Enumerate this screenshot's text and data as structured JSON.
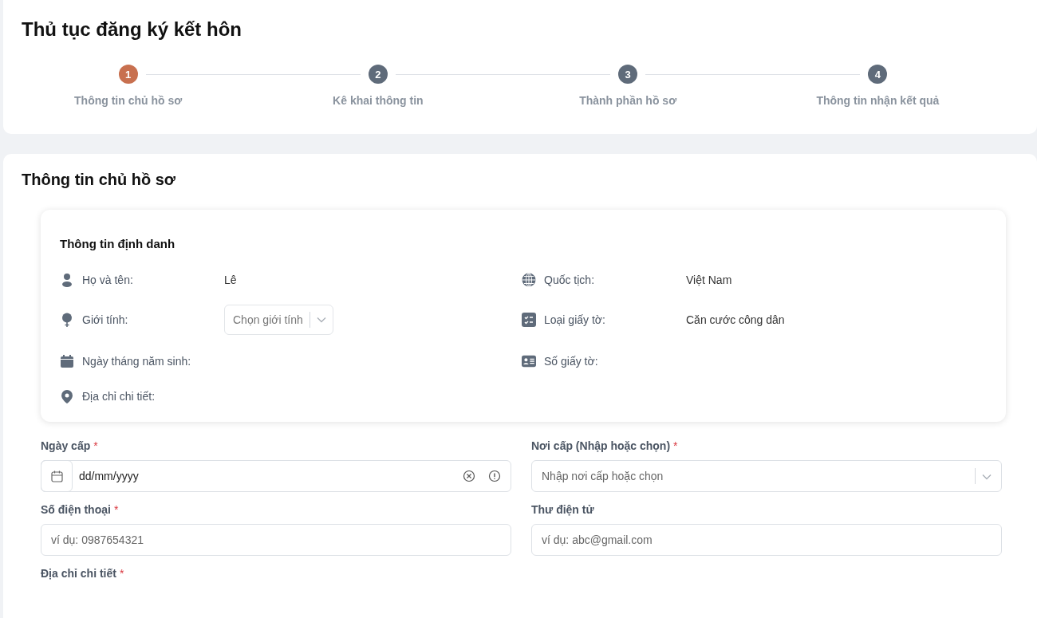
{
  "title": "Thủ tục đăng ký kết hôn",
  "steps": [
    {
      "number": "1",
      "label": "Thông tin chủ hồ sơ",
      "selected": true
    },
    {
      "number": "2",
      "label": "Kê khai thông tin",
      "selected": false
    },
    {
      "number": "3",
      "label": "Thành phần hồ sơ",
      "selected": false
    },
    {
      "number": "4",
      "label": "Thông tin nhận kết quả",
      "selected": false
    }
  ],
  "section_title": "Thông tin chủ hồ sơ",
  "identity": {
    "title": "Thông tin định danh",
    "left": [
      {
        "label": "Họ và tên:",
        "kind": "text",
        "value": "Lê"
      },
      {
        "label": "Giới tính:",
        "kind": "select",
        "placeholder": "Chọn giới tính"
      },
      {
        "label": "Ngày tháng năm sinh:",
        "kind": "text"
      },
      {
        "label": "Địa chỉ chi tiết:",
        "kind": "text"
      }
    ],
    "right": [
      {
        "label": "Quốc tịch:",
        "kind": "text",
        "value": "Việt Nam"
      },
      {
        "label": "Loại giấy tờ:",
        "kind": "text",
        "value": "Căn cước công dân"
      },
      {
        "label": "Số giấy tờ:",
        "kind": "text"
      }
    ]
  },
  "required_mark": "*",
  "fields": [
    {
      "label": "Ngày cấp",
      "required": true,
      "kind": "date",
      "value": "dd/mm/yyyy"
    },
    {
      "label": "Nơi cấp (Nhập hoặc chọn)",
      "required": true,
      "kind": "select",
      "placeholder": "Nhập nơi cấp hoặc chọn"
    },
    {
      "label": "Số điện thoại",
      "required": true,
      "kind": "text",
      "placeholder": "ví dụ: 0987654321"
    },
    {
      "label": "Thư điện tử",
      "required": false,
      "kind": "text",
      "placeholder": "ví dụ: abc@gmail.com"
    },
    {
      "label": "Địa chỉ chi tiết",
      "required": true,
      "kind": "label"
    }
  ]
}
